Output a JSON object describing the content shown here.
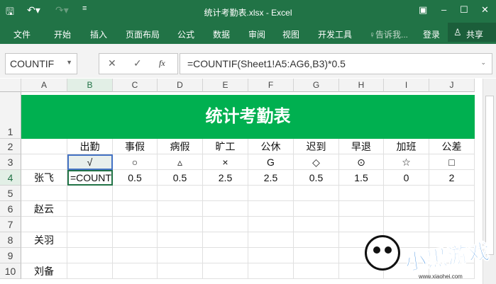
{
  "window": {
    "title": "统计考勤表.xlsx - Excel"
  },
  "quick_access": {
    "save_icon": "save-icon",
    "undo_icon": "undo-icon",
    "redo_icon": "redo-icon",
    "customize_icon": "customize-icon"
  },
  "ribbon": {
    "tabs": [
      "文件",
      "开始",
      "插入",
      "页面布局",
      "公式",
      "数据",
      "审阅",
      "视图",
      "开发工具"
    ],
    "tell_me": "告诉我...",
    "login": "登录",
    "share": "共享"
  },
  "formula_bar": {
    "name_box": "COUNTIF",
    "formula": "=COUNTIF(Sheet1!A5:AG6,B3)*0.5",
    "fx": "fx"
  },
  "sheet": {
    "columns": [
      "A",
      "B",
      "C",
      "D",
      "E",
      "F",
      "G",
      "H",
      "I",
      "J"
    ],
    "rows": [
      "1",
      "2",
      "3",
      "4",
      "5",
      "6",
      "7",
      "8",
      "9",
      "10"
    ],
    "title": "统计考勤表",
    "headers": [
      "",
      "出勤",
      "事假",
      "病假",
      "旷工",
      "公休",
      "迟到",
      "早退",
      "加班",
      "公差"
    ],
    "symbols": [
      "",
      "√",
      "○",
      "▵",
      "×",
      "G",
      "◇",
      "⊙",
      "☆",
      "□"
    ],
    "row4": [
      "张飞",
      "=COUNT",
      "0.5",
      "0.5",
      "2.5",
      "2.5",
      "0.5",
      "1.5",
      "0",
      "2"
    ],
    "names": {
      "r6": "赵云",
      "r8": "关羽",
      "r10": "刘备"
    },
    "title_color": "#00b050"
  },
  "watermark": {
    "text": "小黑游戏",
    "url_text": "www.xiaohei.com"
  }
}
